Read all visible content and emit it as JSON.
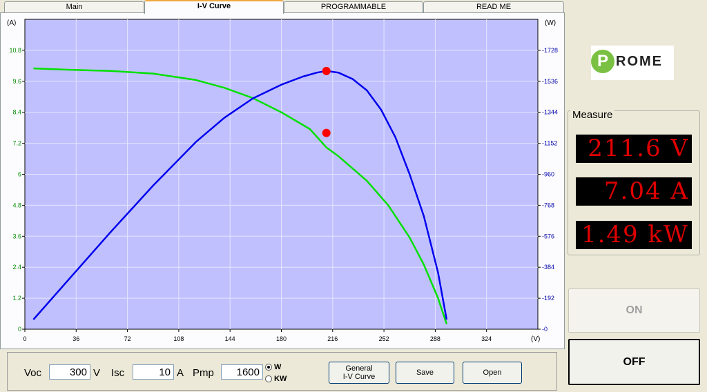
{
  "tabs": [
    {
      "label": "Main",
      "active": false
    },
    {
      "label": "I-V Curve",
      "active": true
    },
    {
      "label": "PROGRAMMABLE",
      "active": false
    },
    {
      "label": "READ ME",
      "active": false
    }
  ],
  "chart_data": {
    "type": "line",
    "left_unit": "(A)",
    "right_unit": "(W)",
    "x_unit": "(V)",
    "xlim": [
      0,
      360
    ],
    "ylim_left": [
      0,
      12
    ],
    "ylim_right": [
      0,
      1920
    ],
    "x_ticks": [
      "0",
      "36",
      "72",
      "108",
      "144",
      "180",
      "216",
      "252",
      "288",
      "324"
    ],
    "y_left_ticks": [
      "0",
      "1.2",
      "2.4",
      "3.6",
      "4.8",
      "6",
      "7.2",
      "8.4",
      "9.6",
      "10.8"
    ],
    "y_right_ticks": [
      "0",
      "192",
      "384",
      "576",
      "768",
      "960",
      "1152",
      "1344",
      "1536",
      "1728"
    ],
    "colors": {
      "plot_bg": "#c0c0ff",
      "current": "#00e000",
      "power": "#0000ee",
      "marker": "#ff0000",
      "left_axis": "#008800",
      "right_axis": "#0000aa"
    },
    "series": [
      {
        "axis": "left",
        "color": "#00e000",
        "x": [
          6,
          30,
          60,
          90,
          120,
          140,
          160,
          180,
          200,
          211.6,
          220,
          240,
          255,
          270,
          280,
          290,
          296
        ],
        "y": [
          10.1,
          10.05,
          10.0,
          9.9,
          9.65,
          9.35,
          8.95,
          8.4,
          7.75,
          7.04,
          6.7,
          5.75,
          4.8,
          3.55,
          2.5,
          1.2,
          0.2
        ]
      },
      {
        "axis": "right",
        "color": "#0000ee",
        "x": [
          6,
          30,
          60,
          90,
          120,
          140,
          160,
          180,
          195,
          205,
          211.6,
          220,
          230,
          240,
          250,
          260,
          270,
          280,
          290,
          296
        ],
        "y": [
          60,
          300,
          600,
          890,
          1160,
          1310,
          1430,
          1515,
          1565,
          1590,
          1600,
          1590,
          1550,
          1480,
          1360,
          1190,
          960,
          700,
          350,
          60
        ]
      }
    ],
    "markers": [
      {
        "x": 211.6,
        "y": 1600,
        "axis": "right"
      },
      {
        "x": 211.6,
        "y": 7.6,
        "axis": "left"
      }
    ]
  },
  "bottom": {
    "voc_label": "Voc",
    "voc_value": "300",
    "voc_unit": "V",
    "isc_label": "Isc",
    "isc_value": "10",
    "isc_unit": "A",
    "pmp_label": "Pmp",
    "pmp_value": "1600",
    "radio_w": "W",
    "radio_kw": "KW",
    "btn_general_1": "General",
    "btn_general_2": "I-V Curve",
    "btn_save": "Save",
    "btn_open": "Open"
  },
  "logo": {
    "letter": "P",
    "word": "ROME"
  },
  "measure": {
    "title": "Measure",
    "voltage": "211.6 V",
    "current": "7.04 A",
    "power": "1.49 kW"
  },
  "on_label": "ON",
  "off_label": "OFF"
}
